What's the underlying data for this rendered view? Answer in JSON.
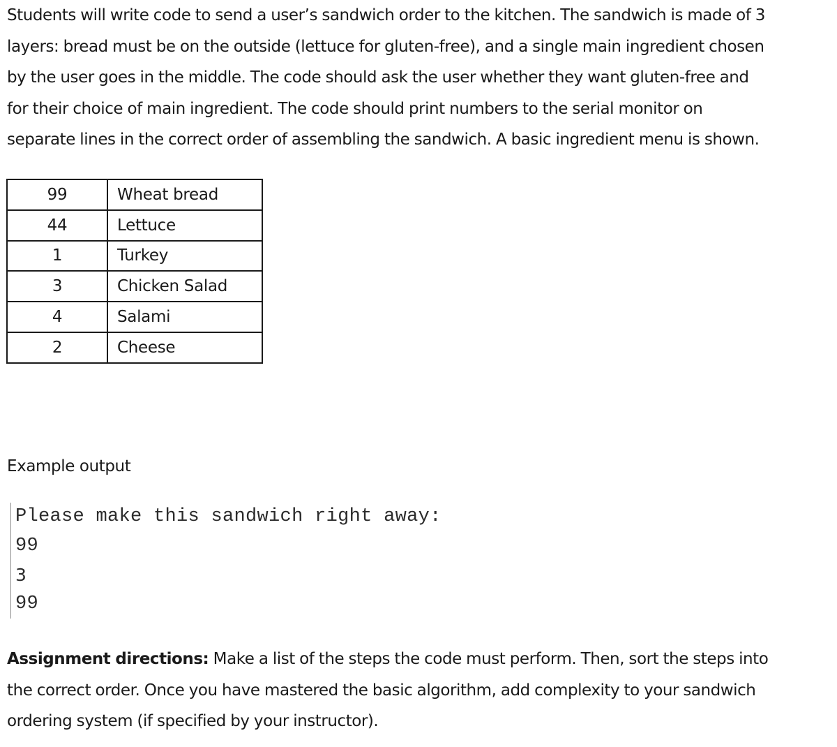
{
  "intro": {
    "lines": [
      "Students will write code to send a user’s sandwich order to the kitchen. The sandwich is made of 3",
      "layers: bread must be on the outside (lettuce for gluten-free), and a single main ingredient chosen",
      "by the user goes in the middle. The code should ask the user whether they want gluten-free and",
      "for their choice of main ingredient. The code should print numbers to the serial monitor on",
      "separate lines in the correct order of assembling the sandwich. A basic ingredient menu is shown."
    ]
  },
  "menu": {
    "rows": [
      {
        "code": "99",
        "ingredient": "Wheat bread"
      },
      {
        "code": "44",
        "ingredient": "Lettuce"
      },
      {
        "code": "1",
        "ingredient": "Turkey"
      },
      {
        "code": "3",
        "ingredient": "Chicken Salad"
      },
      {
        "code": "4",
        "ingredient": "Salami"
      },
      {
        "code": "2",
        "ingredient": "Cheese"
      }
    ]
  },
  "example": {
    "label": "Example output",
    "serial_lines": [
      "Please make this sandwich right away:",
      "99",
      "3",
      "99"
    ]
  },
  "directions": {
    "bold_label": "Assignment directions:",
    "lines": [
      " Make a list of the steps the code must perform. Then, sort the steps into",
      "the correct order. Once you have mastered the basic algorithm, add complexity to your sandwich",
      "ordering system (if specified by your instructor)."
    ]
  }
}
